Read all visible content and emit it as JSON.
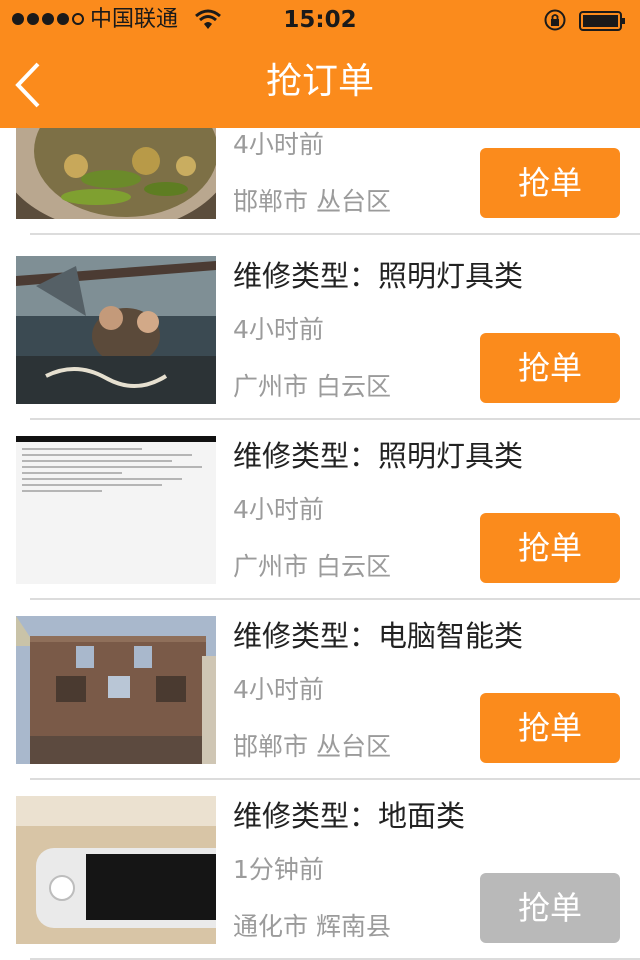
{
  "status_bar": {
    "carrier": "中国联通",
    "time": "15:02"
  },
  "nav": {
    "title": "抢订单",
    "back_icon": "chevron-left-icon"
  },
  "colors": {
    "accent": "#fb8b1c",
    "disabled": "#b9b9b9"
  },
  "orders": [
    {
      "title": "",
      "time": "4小时前",
      "location": "邯郸市 丛台区",
      "button": "抢单",
      "enabled": true,
      "image": "pickled-vegetables-photo"
    },
    {
      "title": "维修类型：照明灯具类",
      "time": "4小时前",
      "location": "广州市 白云区",
      "button": "抢单",
      "enabled": true,
      "image": "drama-poster-photo"
    },
    {
      "title": "维修类型：照明灯具类",
      "time": "4小时前",
      "location": "广州市 白云区",
      "button": "抢单",
      "enabled": true,
      "image": "text-screenshot-photo"
    },
    {
      "title": "维修类型：电脑智能类",
      "time": "4小时前",
      "location": "邯郸市 丛台区",
      "button": "抢单",
      "enabled": true,
      "image": "brick-building-photo"
    },
    {
      "title": "维修类型：地面类",
      "time": "1分钟前",
      "location": "通化市 辉南县",
      "button": "抢单",
      "enabled": false,
      "image": "phone-photo"
    }
  ]
}
